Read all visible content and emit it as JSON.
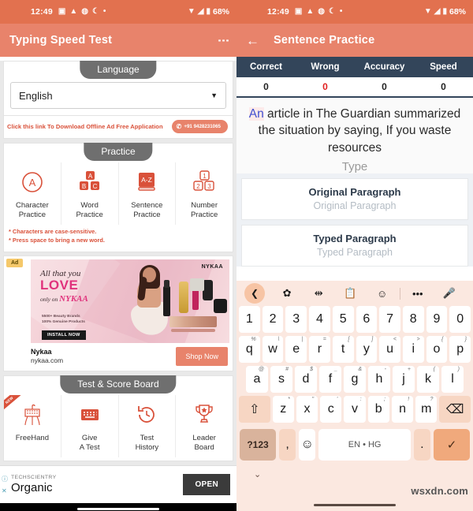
{
  "colors": {
    "status_bar": "#e2714f",
    "app_bar": "#e8836b",
    "accent": "#d9513a",
    "stats_header": "#33455a",
    "keyboard_bg": "#fbe8e0",
    "highlight_text": "#3f4fd0"
  },
  "status_bar": {
    "time": "12:49",
    "battery": "68%",
    "icons": [
      "sim-card-icon",
      "triangle-icon",
      "whatsapp-icon",
      "moon-icon",
      "dot-icon"
    ],
    "right_icons": [
      "wifi-icon",
      "signal-icon",
      "battery-icon"
    ]
  },
  "left_screen": {
    "app_bar": {
      "title": "Typing Speed Test",
      "menu_icon": "overflow-menu-icon"
    },
    "language_section": {
      "pill_label": "Language",
      "selected": "English",
      "caret_icon": "chevron-down-icon",
      "link_text": "Click this link To Download Offline Ad Free Application",
      "phone": "+91 9428231065",
      "phone_icon": "phone-icon"
    },
    "practice_section": {
      "pill_label": "Practice",
      "tiles": [
        {
          "icon": "character-circle-a-icon",
          "label_line1": "Character",
          "label_line2": "Practice"
        },
        {
          "icon": "abc-blocks-icon",
          "label_line1": "Word",
          "label_line2": "Practice"
        },
        {
          "icon": "a-z-book-icon",
          "label_line1": "Sentence",
          "label_line2": "Practice"
        },
        {
          "icon": "number-blocks-icon",
          "label_line1": "Number",
          "label_line2": "Practice"
        }
      ],
      "notes": [
        "* Characters are case-sensitive.",
        "* Press space to bring a new word."
      ]
    },
    "ad": {
      "badge": "Ad",
      "headline_line1": "All that you",
      "headline_line2": "LOVE",
      "headline_line3": "only on",
      "brand_inline": "NYKAA",
      "bullets_line1": "5500+ Beauty Brands",
      "bullets_line2": "100% Genuine Products",
      "cta": "INSTALL NOW",
      "logo": "NYKAA",
      "advertiser": "Nykaa",
      "url": "nykaa.com",
      "button": "Shop Now"
    },
    "score_section": {
      "pill_label": "Test & Score Board",
      "tiles": [
        {
          "icon": "freehand-icon",
          "ribbon": "NEW",
          "label_line1": "FreeHand",
          "label_line2": ""
        },
        {
          "icon": "keyboard-icon",
          "label_line1": "Give",
          "label_line2": "A Test"
        },
        {
          "icon": "history-clock-icon",
          "label_line1": "Test",
          "label_line2": "History"
        },
        {
          "icon": "trophy-icon",
          "label_line1": "Leader",
          "label_line2": "Board"
        }
      ]
    },
    "bottom_ad": {
      "advertiser": "TECHSCIENTRY",
      "title": "Organic",
      "button": "OPEN",
      "info_icon": "info-icon",
      "close_icon": "close-icon"
    }
  },
  "right_screen": {
    "app_bar": {
      "title": "Sentence Practice",
      "back_icon": "back-arrow-icon"
    },
    "stats": {
      "headers": [
        "Correct",
        "Wrong",
        "Accuracy",
        "Speed"
      ],
      "values": [
        "0",
        "0",
        "0",
        "0"
      ]
    },
    "prompt": {
      "highlight_word": "An",
      "rest": " article in The Guardian summarized the situation by saying, If you waste resources",
      "input_placeholder": "Type"
    },
    "paragraphs": [
      {
        "title": "Original Paragraph",
        "placeholder": "Original Paragraph"
      },
      {
        "title": "Typed Paragraph",
        "placeholder": "Typed Paragraph"
      }
    ],
    "keyboard": {
      "toolbar_icons": [
        "back-chevron-icon",
        "gear-icon",
        "cursor-move-icon",
        "clipboard-icon",
        "sticker-icon",
        "more-icon",
        "microphone-icon"
      ],
      "number_row": [
        "1",
        "2",
        "3",
        "4",
        "5",
        "6",
        "7",
        "8",
        "9",
        "0"
      ],
      "row1": [
        {
          "key": "q",
          "sup": "%"
        },
        {
          "key": "w",
          "sup": "\\"
        },
        {
          "key": "e",
          "sup": "|"
        },
        {
          "key": "r",
          "sup": "="
        },
        {
          "key": "t",
          "sup": "["
        },
        {
          "key": "y",
          "sup": "]"
        },
        {
          "key": "u",
          "sup": "<"
        },
        {
          "key": "i",
          "sup": ">"
        },
        {
          "key": "o",
          "sup": "{"
        },
        {
          "key": "p",
          "sup": "}"
        }
      ],
      "row2": [
        {
          "key": "a",
          "sup": "@"
        },
        {
          "key": "s",
          "sup": "#"
        },
        {
          "key": "d",
          "sup": "$"
        },
        {
          "key": "f",
          "sup": "_"
        },
        {
          "key": "g",
          "sup": "&"
        },
        {
          "key": "h",
          "sup": "-"
        },
        {
          "key": "j",
          "sup": "+"
        },
        {
          "key": "k",
          "sup": "("
        },
        {
          "key": "l",
          "sup": ")"
        }
      ],
      "row3": [
        {
          "key": "z",
          "sup": "*"
        },
        {
          "key": "x",
          "sup": "\""
        },
        {
          "key": "c",
          "sup": "'"
        },
        {
          "key": "v",
          "sup": ":"
        },
        {
          "key": "b",
          "sup": ";"
        },
        {
          "key": "n",
          "sup": "!"
        },
        {
          "key": "m",
          "sup": "?"
        }
      ],
      "shift_icon": "shift-icon",
      "backspace_icon": "backspace-icon",
      "symbols_key": "?123",
      "comma_key": ",",
      "emoji_icon": "emoji-icon",
      "space_label": "EN • HG",
      "period_key": ".",
      "enter_icon": "checkmark-icon",
      "hide_icon": "chevron-down-icon"
    },
    "watermark": "wsxdn.com"
  }
}
